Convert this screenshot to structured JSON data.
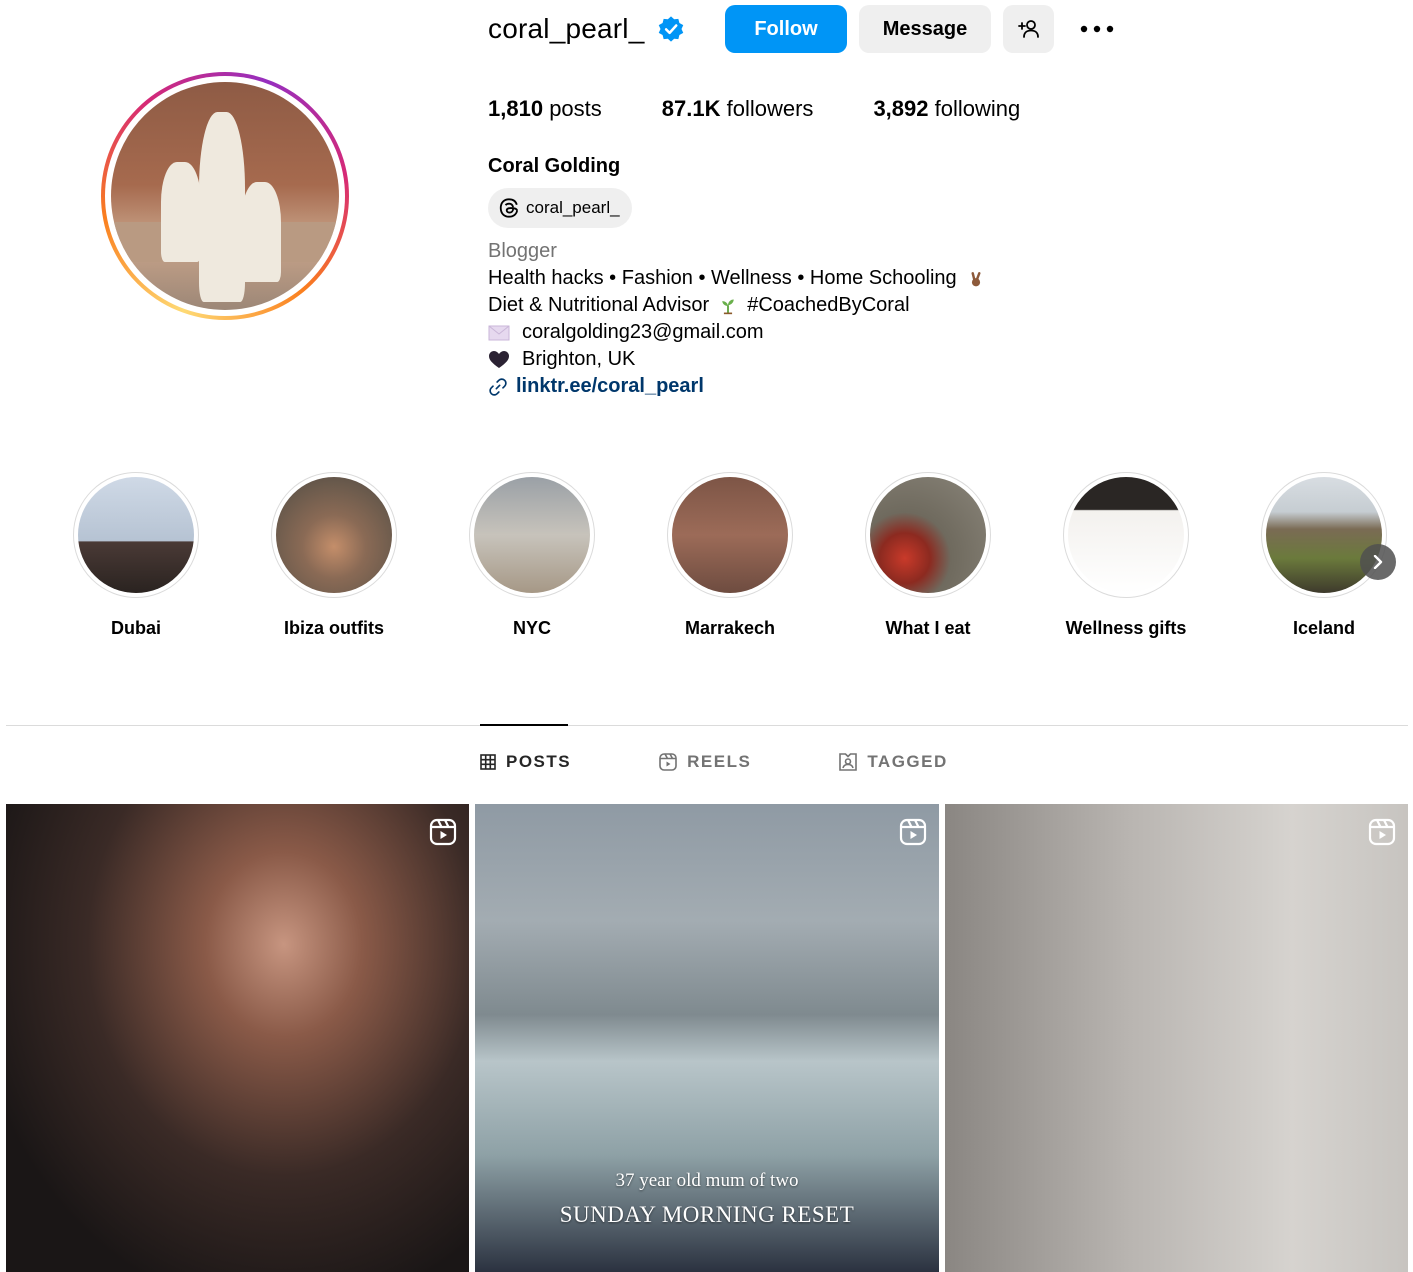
{
  "profile": {
    "username": "coral_pearl_",
    "verified": true,
    "full_name": "Coral Golding",
    "threads_handle": "coral_pearl_",
    "buttons": {
      "follow": "Follow",
      "message": "Message"
    },
    "stats": [
      {
        "value": "1,810",
        "label": "posts"
      },
      {
        "value": "87.1K",
        "label": "followers"
      },
      {
        "value": "3,892",
        "label": "following"
      }
    ],
    "bio": {
      "category": "Blogger",
      "line1": "Health hacks • Fashion • Wellness • Home Schooling",
      "line2_a": "Diet & Nutritional Advisor",
      "line2_b": "#CoachedByCoral",
      "email": "coralgolding23@gmail.com",
      "location": "Brighton, UK",
      "link": "linktr.ee/coral_pearl"
    }
  },
  "highlights": [
    {
      "label": "Dubai"
    },
    {
      "label": "Ibiza outfits"
    },
    {
      "label": "NYC"
    },
    {
      "label": "Marrakech"
    },
    {
      "label": "What I eat"
    },
    {
      "label": "Wellness gifts"
    },
    {
      "label": "Iceland"
    }
  ],
  "tabs": {
    "posts": "POSTS",
    "reels": "REELS",
    "tagged": "TAGGED"
  },
  "posts": [
    {
      "type": "reel"
    },
    {
      "type": "reel",
      "overlay_line1": "37 year old mum of two",
      "overlay_line2": "SUNDAY MORNING RESET"
    },
    {
      "type": "reel"
    }
  ],
  "colors": {
    "primary_button": "#0095f6",
    "link": "#00376b",
    "verified": "#0095f6"
  }
}
